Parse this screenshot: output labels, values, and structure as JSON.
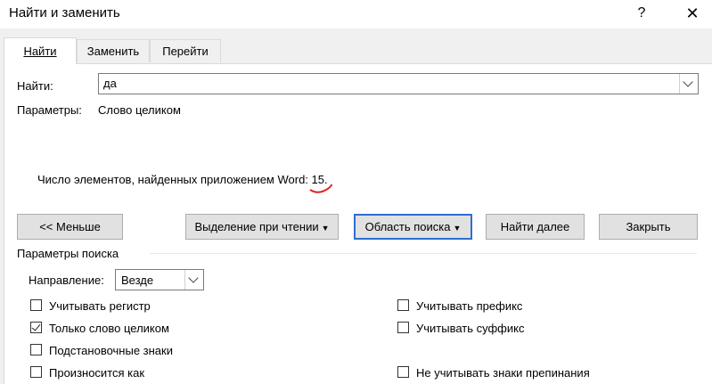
{
  "window": {
    "title": "Найти и заменить",
    "help": "?",
    "close": "✕"
  },
  "tabs": [
    {
      "label": "Найти",
      "active": true
    },
    {
      "label": "Заменить",
      "active": false
    },
    {
      "label": "Перейти",
      "active": false
    }
  ],
  "find": {
    "label": "Найти:",
    "value": "да"
  },
  "params": {
    "label": "Параметры:",
    "value": "Слово целиком"
  },
  "status": "Число элементов, найденных приложением Word: 15.",
  "buttons": {
    "less": "<< Меньше",
    "reading_highlight": "Выделение при чтении",
    "find_in": "Область поиска",
    "find_next": "Найти далее",
    "close": "Закрыть"
  },
  "search_options": {
    "group_label": "Параметры поиска",
    "direction_label": "Направление:",
    "direction_value": "Везде"
  },
  "options_left": [
    {
      "label": "Учитывать регистр",
      "checked": false
    },
    {
      "label": "Только слово целиком",
      "checked": true
    },
    {
      "label": "Подстановочные знаки",
      "checked": false
    },
    {
      "label": "Произносится как",
      "checked": false
    }
  ],
  "options_right": [
    {
      "label": "Учитывать префикс",
      "checked": false
    },
    {
      "label": "Учитывать суффикс",
      "checked": false
    },
    {
      "label": "Не учитывать знаки препинания",
      "checked": false
    }
  ],
  "colors": {
    "focus_border": "#2e6ed1",
    "annotation": "#e02020"
  }
}
